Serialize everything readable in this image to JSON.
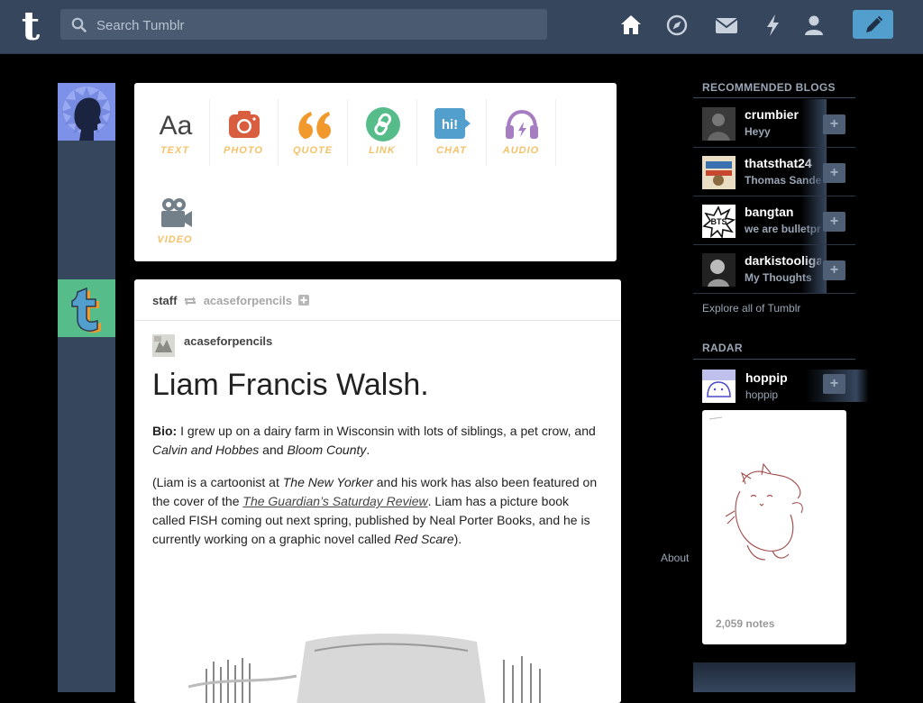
{
  "header": {
    "search_placeholder": "Search Tumblr",
    "logo": "t",
    "icons": [
      "home-icon",
      "explore-icon",
      "inbox-icon",
      "activity-icon",
      "account-icon",
      "compose-icon"
    ]
  },
  "composer": {
    "types": [
      {
        "label": "TEXT",
        "color": "#444444"
      },
      {
        "label": "PHOTO",
        "color": "#d95e40"
      },
      {
        "label": "QUOTE",
        "color": "#f2992e"
      },
      {
        "label": "LINK",
        "color": "#56bc8a"
      },
      {
        "label": "CHAT",
        "color": "#529ecc"
      },
      {
        "label": "AUDIO",
        "color": "#a77dc2"
      },
      {
        "label": "VIDEO",
        "color": "#748089"
      }
    ],
    "label_color": "#f5c26b"
  },
  "post": {
    "blog": "staff",
    "reblogged_from": "acaseforpencils",
    "author": "acaseforpencils",
    "title": "Liam Francis Walsh.",
    "bio_label": "Bio:",
    "bio_text": " I grew up on a dairy farm in Wisconsin with lots of siblings, a pet crow, and ",
    "bio_i1": "Calvin and Hobbes",
    "bio_and": " and ",
    "bio_i2": "Bloom County",
    "bio_end": ".",
    "p2_a": "(Liam is a cartoonist at ",
    "p2_i1": "The New Yorker",
    "p2_b": " and his work has also been featured on the cover of the ",
    "p2_link": "The Guardian’s Saturday Review",
    "p2_c": ". Liam has a picture book called FISH coming out next spring, published by Neal Porter Books, and he is currently working on a graphic novel called ",
    "p2_i2": "Red Scare",
    "p2_d": ")."
  },
  "sidebar": {
    "recommended_title": "RECOMMENDED BLOGS",
    "recommended": [
      {
        "name": "crumbier",
        "desc": "Heyy"
      },
      {
        "name": "thatsthat24",
        "desc": "Thomas Sanders"
      },
      {
        "name": "bangtan",
        "desc": "we are bulletproof"
      },
      {
        "name": "darkistooligan",
        "desc": "My Thoughts"
      }
    ],
    "explore": "Explore all of Tumblr",
    "radar_title": "RADAR",
    "radar": {
      "name": "hoppip",
      "desc": "hoppip",
      "notes": "2,059 notes"
    },
    "follow_label": "+",
    "about": "About"
  },
  "colors": {
    "header": "#36465d",
    "accent": "#529ecc",
    "background": "#000000"
  }
}
